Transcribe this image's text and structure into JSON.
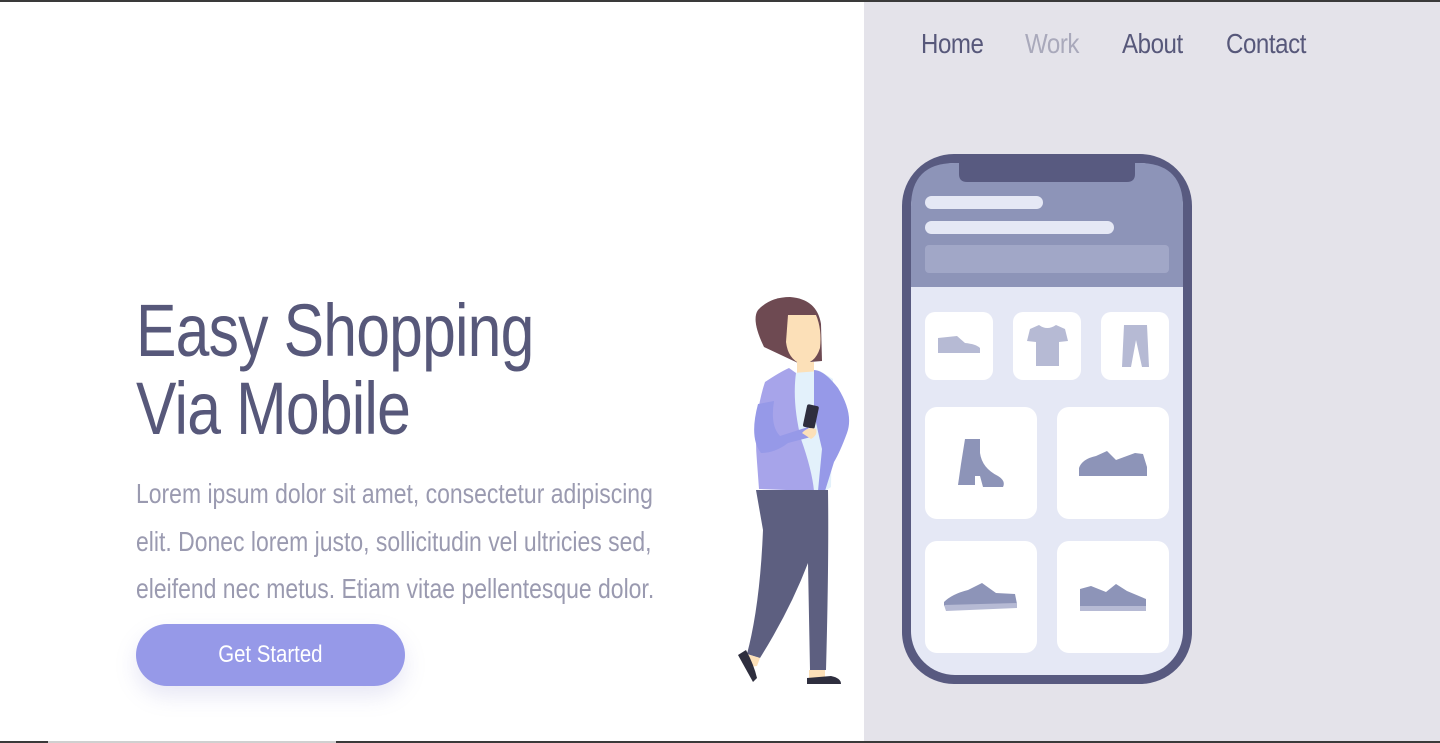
{
  "nav": {
    "items": [
      {
        "label": "Home",
        "active": false
      },
      {
        "label": "Work",
        "active": true
      },
      {
        "label": "About",
        "active": false
      },
      {
        "label": "Contact",
        "active": false
      }
    ]
  },
  "hero": {
    "title_line1": "Easy Shopping",
    "title_line2": "Via Mobile",
    "paragraph_line1": "Lorem ipsum dolor sit amet, consectetur adipiscing",
    "paragraph_line2": "elit. Donec lorem justo, sollicitudin vel ultricies sed,",
    "paragraph_line3": "eleifend nec metus. Etiam vitae pellentesque dolor.",
    "cta_label": "Get Started"
  },
  "illustration": {
    "phone_products": [
      "shoe-icon",
      "tshirt-icon",
      "pants-icon",
      "boot-icon",
      "sneaker-icon",
      "sneaker-icon",
      "sneaker-icon"
    ],
    "colors": {
      "phone_frame": "#585a80",
      "phone_header": "#8d94b8",
      "phone_body": "#e5e8f5",
      "product": "#8d94b8",
      "accent": "#9699e8"
    }
  },
  "colors": {
    "text_primary": "#57587a",
    "text_muted": "#9a9ab0",
    "nav_active": "#a9a9bb",
    "right_panel": "#e4e3ea",
    "button": "#9699e8"
  }
}
